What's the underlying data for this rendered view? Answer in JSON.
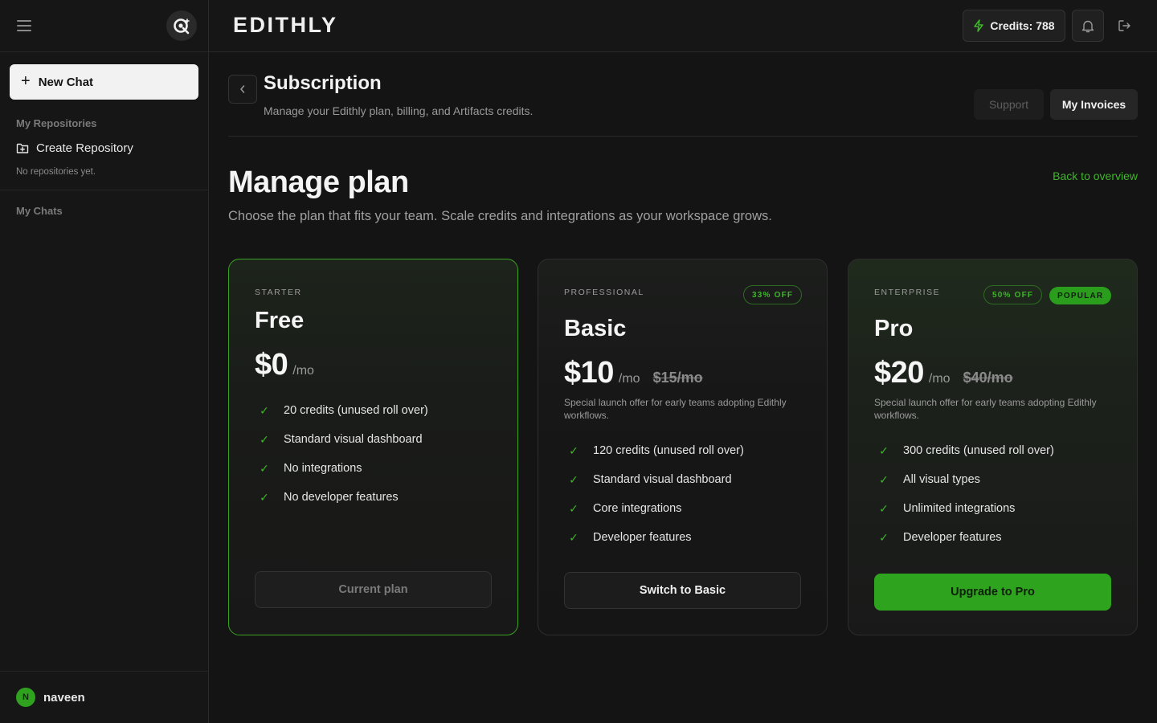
{
  "sidebar": {
    "new_chat_label": "New Chat",
    "repositories_heading": "My Repositories",
    "create_repository_label": "Create Repository",
    "no_repositories_text": "No repositories yet.",
    "chats_heading": "My Chats",
    "user": {
      "initial": "N",
      "name": "naveen"
    }
  },
  "topbar": {
    "brand": "EDITHLY",
    "credits_label": "Credits: 788"
  },
  "header": {
    "title": "Subscription",
    "subtitle": "Manage your Edithly plan, billing, and Artifacts credits.",
    "support_label": "Support",
    "invoices_label": "My Invoices"
  },
  "manage": {
    "title": "Manage plan",
    "subtitle": "Choose the plan that fits your team. Scale credits and integrations as your workspace grows.",
    "back_link": "Back to overview"
  },
  "plans": [
    {
      "tier": "STARTER",
      "name": "Free",
      "price": "$0",
      "per": "/mo",
      "features": [
        "20 credits (unused roll over)",
        "Standard visual dashboard",
        "No integrations",
        "No developer features"
      ],
      "button": "Current plan"
    },
    {
      "tier": "PROFESSIONAL",
      "name": "Basic",
      "badge": "33% OFF",
      "price": "$10",
      "per": "/mo",
      "old_price": "$15/mo",
      "note": "Special launch offer for early teams adopting Edithly workflows.",
      "features": [
        "120 credits (unused roll over)",
        "Standard visual dashboard",
        "Core integrations",
        "Developer features"
      ],
      "button": "Switch to Basic"
    },
    {
      "tier": "ENTERPRISE",
      "name": "Pro",
      "badge": "50% OFF",
      "badge2": "POPULAR",
      "price": "$20",
      "per": "/mo",
      "old_price": "$40/mo",
      "note": "Special launch offer for early teams adopting Edithly workflows.",
      "features": [
        "300 credits (unused roll over)",
        "All visual types",
        "Unlimited integrations",
        "Developer features"
      ],
      "button": "Upgrade to Pro"
    }
  ],
  "colors": {
    "accent": "#3fb52a",
    "background": "#141414"
  }
}
